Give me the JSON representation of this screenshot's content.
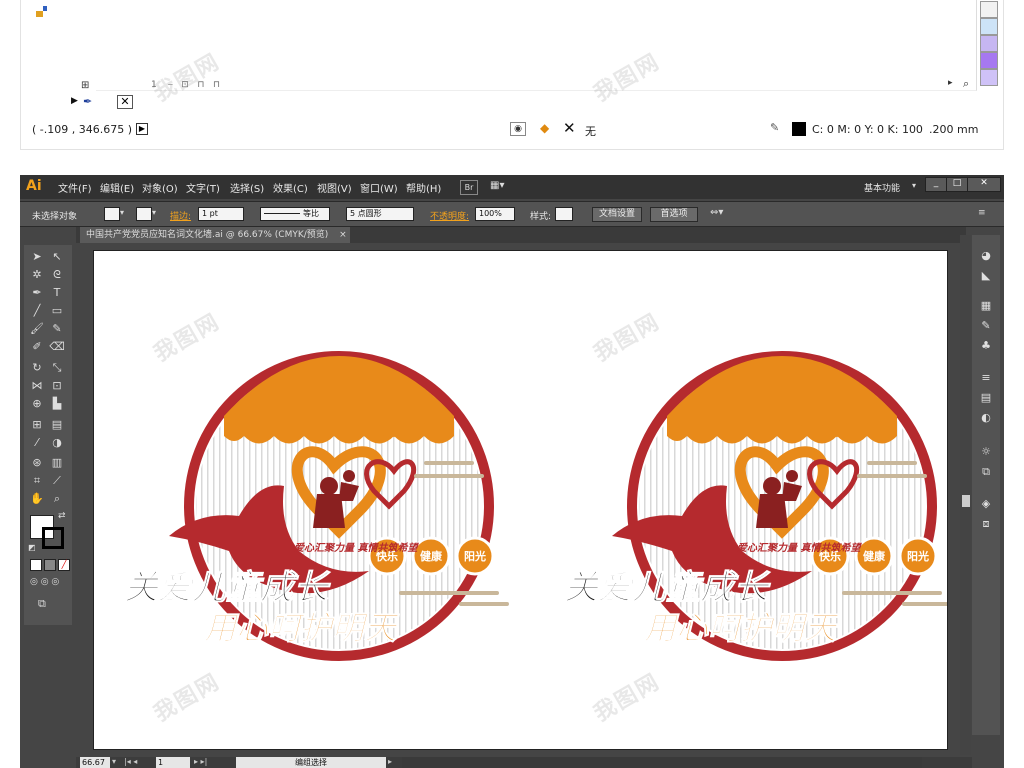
{
  "top_panel": {
    "coords": "( -.109 , 346.675 )",
    "fill_label": "无",
    "color_readout": "C: 0 M: 0 Y: 0 K: 100",
    "stroke_width": ".200 mm",
    "swatch_colors": [
      "#cde3f7",
      "#c6b6f2",
      "#a678f0",
      "#cfc2f7"
    ]
  },
  "app": {
    "logo": "Ai",
    "menu": [
      "文件(F)",
      "编辑(E)",
      "对象(O)",
      "文字(T)",
      "选择(S)",
      "效果(C)",
      "视图(V)",
      "窗口(W)",
      "帮助(H)"
    ],
    "bridge_label": "Br",
    "workspace": "基本功能",
    "window_controls": [
      "_",
      "□",
      "✕"
    ]
  },
  "control": {
    "selection": "未选择对象",
    "stroke_label": "描边:",
    "stroke_value": "1 pt",
    "stroke_profile": "等比",
    "brush": "5 点圆形",
    "opacity_label": "不透明度:",
    "opacity_value": "100%",
    "style_label": "样式:",
    "doc_setup": "文档设置",
    "preferences": "首选项"
  },
  "document": {
    "tab_title": "中国共产党党员应知名词文化墙.ai @ 66.67% (CMYK/预览)",
    "tab_close": "×"
  },
  "artwork": {
    "tagline": "爱心汇聚力量  真情共筑希望",
    "badges": [
      "快乐",
      "健康",
      "阳光"
    ],
    "line1": "关爱儿童成长",
    "line2": "用心呵护明天",
    "colors": {
      "red": "#b52a2e",
      "orange": "#e88a1a",
      "dark": "#1a1a1a"
    }
  },
  "status": {
    "zoom": "66.67",
    "page": "1",
    "tool": "编组选择"
  },
  "watermark": "我图网"
}
